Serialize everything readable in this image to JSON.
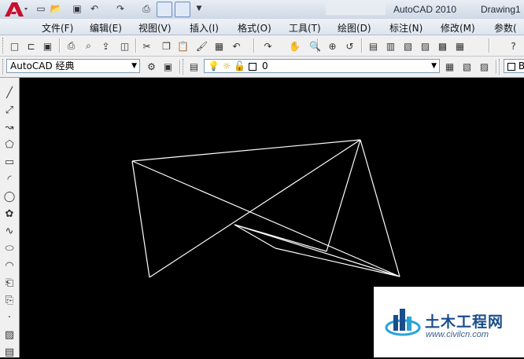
{
  "window": {
    "title": "AutoCAD 2010",
    "drawing_name": "Drawing1"
  },
  "quick_access": [
    {
      "icon": "new-icon",
      "glyph": "▭"
    },
    {
      "icon": "open-icon",
      "glyph": "📂"
    },
    {
      "icon": "save-icon",
      "glyph": "▣"
    },
    {
      "icon": "undo-icon",
      "glyph": "↶"
    },
    {
      "icon": "redo-icon",
      "glyph": "↷"
    },
    {
      "icon": "print-icon",
      "glyph": "⎙"
    }
  ],
  "menus": [
    "文件(F)",
    "编辑(E)",
    "视图(V)",
    "插入(I)",
    "格式(O)",
    "工具(T)",
    "绘图(D)",
    "标注(N)",
    "修改(M)",
    "参数("
  ],
  "toolbar_standard": [
    {
      "icon": "new-icon",
      "glyph": "□"
    },
    {
      "icon": "open-icon",
      "glyph": "⊏"
    },
    {
      "icon": "save-icon",
      "glyph": "▣"
    },
    {
      "icon": "plot-icon",
      "glyph": "⎙"
    },
    {
      "icon": "plot-preview-icon",
      "glyph": "⌕"
    },
    {
      "icon": "publish-icon",
      "glyph": "⇪"
    },
    {
      "icon": "3d-dwf-icon",
      "glyph": "◫"
    },
    {
      "icon": "cut-icon",
      "glyph": "✂"
    },
    {
      "icon": "copy-icon",
      "glyph": "❐"
    },
    {
      "icon": "paste-icon",
      "glyph": "📋"
    },
    {
      "icon": "match-properties-icon",
      "glyph": "🖌"
    },
    {
      "icon": "block-editor-icon",
      "glyph": "▦"
    },
    {
      "icon": "undo-icon",
      "glyph": "↶"
    },
    {
      "icon": "redo-icon",
      "glyph": "↷"
    },
    {
      "icon": "pan-icon",
      "glyph": "✋"
    },
    {
      "icon": "zoom-realtime-icon",
      "glyph": "🔍"
    },
    {
      "icon": "zoom-window-icon",
      "glyph": "⊕"
    },
    {
      "icon": "zoom-previous-icon",
      "glyph": "↺"
    },
    {
      "icon": "properties-icon",
      "glyph": "▤"
    },
    {
      "icon": "design-center-icon",
      "glyph": "▥"
    },
    {
      "icon": "tool-palettes-icon",
      "glyph": "▧"
    },
    {
      "icon": "sheet-set-icon",
      "glyph": "▨"
    },
    {
      "icon": "markup-icon",
      "glyph": "▩"
    },
    {
      "icon": "quickcalc-icon",
      "glyph": "▦"
    },
    {
      "icon": "help-icon",
      "glyph": "?"
    }
  ],
  "workspace_combo": {
    "value": "AutoCAD 经典"
  },
  "layer_combo": {
    "value": "0"
  },
  "layer_icons": [
    "layer-on-icon",
    "freeze-icon",
    "lock-icon",
    "color-swatch-icon"
  ],
  "properties_combo": {
    "value": "B"
  },
  "draw_tools": [
    {
      "icon": "line-icon",
      "glyph": "╱"
    },
    {
      "icon": "construction-line-icon",
      "glyph": "⤢"
    },
    {
      "icon": "polyline-icon",
      "glyph": "↝"
    },
    {
      "icon": "polygon-icon",
      "glyph": "⬠"
    },
    {
      "icon": "rectangle-icon",
      "glyph": "▭"
    },
    {
      "icon": "arc-icon",
      "glyph": "◜"
    },
    {
      "icon": "circle-icon",
      "glyph": "◯"
    },
    {
      "icon": "revision-cloud-icon",
      "glyph": "✿"
    },
    {
      "icon": "spline-icon",
      "glyph": "∿"
    },
    {
      "icon": "ellipse-icon",
      "glyph": "⬭"
    },
    {
      "icon": "ellipse-arc-icon",
      "glyph": "◠"
    },
    {
      "icon": "insert-block-icon",
      "glyph": "⎗"
    },
    {
      "icon": "make-block-icon",
      "glyph": "⎘"
    },
    {
      "icon": "point-icon",
      "glyph": "·"
    },
    {
      "icon": "hatch-icon",
      "glyph": "▨"
    },
    {
      "icon": "gradient-icon",
      "glyph": "▤"
    }
  ],
  "drawing": {
    "segments": [
      [
        [
          168,
          205
        ],
        [
          458,
          178
        ]
      ],
      [
        [
          458,
          178
        ],
        [
          508,
          352
        ]
      ],
      [
        [
          508,
          352
        ],
        [
          350,
          316
        ]
      ],
      [
        [
          350,
          316
        ],
        [
          298,
          286
        ]
      ],
      [
        [
          298,
          286
        ],
        [
          415,
          320
        ]
      ],
      [
        [
          415,
          320
        ],
        [
          458,
          178
        ]
      ],
      [
        [
          168,
          205
        ],
        [
          190,
          353
        ]
      ],
      [
        [
          190,
          353
        ],
        [
          458,
          178
        ]
      ],
      [
        [
          168,
          205
        ],
        [
          508,
          352
        ]
      ],
      [
        [
          298,
          286
        ],
        [
          508,
          352
        ]
      ]
    ],
    "stroke_color": "#ffffff"
  },
  "watermark": {
    "name_cn": "土木工程网",
    "url": "www.civilcn.com",
    "brand_color": "#1a4d8c"
  }
}
